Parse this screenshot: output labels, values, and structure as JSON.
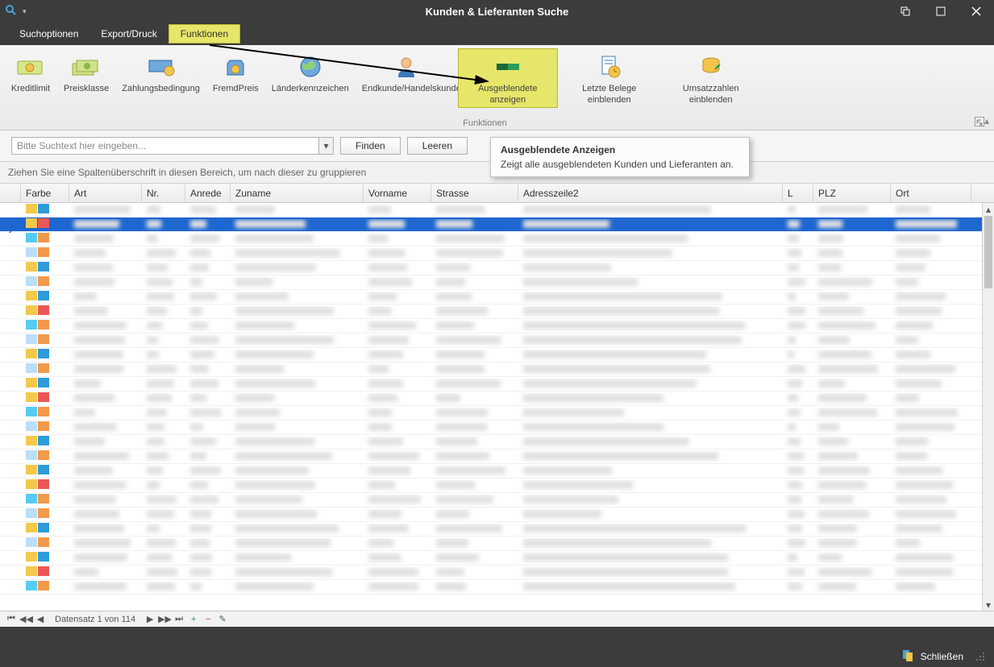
{
  "window": {
    "title": "Kunden & Lieferanten Suche"
  },
  "menu": {
    "items": [
      {
        "label": "Suchoptionen",
        "selected": false
      },
      {
        "label": "Export/Druck",
        "selected": false
      },
      {
        "label": "Funktionen",
        "selected": true
      }
    ]
  },
  "ribbon": {
    "group_label": "Funktionen",
    "buttons": [
      {
        "label": "Kreditlimit"
      },
      {
        "label": "Preisklasse"
      },
      {
        "label": "Zahlungsbedingung"
      },
      {
        "label": "FremdPreis"
      },
      {
        "label": "Länderkennzeichen"
      },
      {
        "label": "Endkunde/Handelskunde"
      },
      {
        "label": "Ausgeblendete anzeigen",
        "selected": true
      },
      {
        "label": "Letzte Belege einblenden"
      },
      {
        "label": "Umsatzzahlen einblenden"
      }
    ]
  },
  "search": {
    "placeholder": "Bitte Suchtext hier eingeben...",
    "find_label": "Finden",
    "clear_label": "Leeren"
  },
  "tooltip": {
    "title": "Ausgeblendete Anzeigen",
    "body": "Zeigt alle ausgeblendeten Kunden und Lieferanten an."
  },
  "groupby": {
    "hint": "Ziehen Sie eine Spaltenüberschrift in diesen Bereich, um nach dieser zu gruppieren"
  },
  "grid": {
    "columns": [
      {
        "label": "Farbe"
      },
      {
        "label": "Art"
      },
      {
        "label": "Nr."
      },
      {
        "label": "Anrede"
      },
      {
        "label": "Zuname"
      },
      {
        "label": "Vorname"
      },
      {
        "label": "Strasse"
      },
      {
        "label": "Adresszeile2"
      },
      {
        "label": "L"
      },
      {
        "label": "PLZ"
      },
      {
        "label": "Ort"
      }
    ],
    "row_count": 27,
    "selected_index": 1
  },
  "nav": {
    "label": "Datensatz 1 von 114"
  },
  "footer": {
    "close_label": "Schließen"
  }
}
